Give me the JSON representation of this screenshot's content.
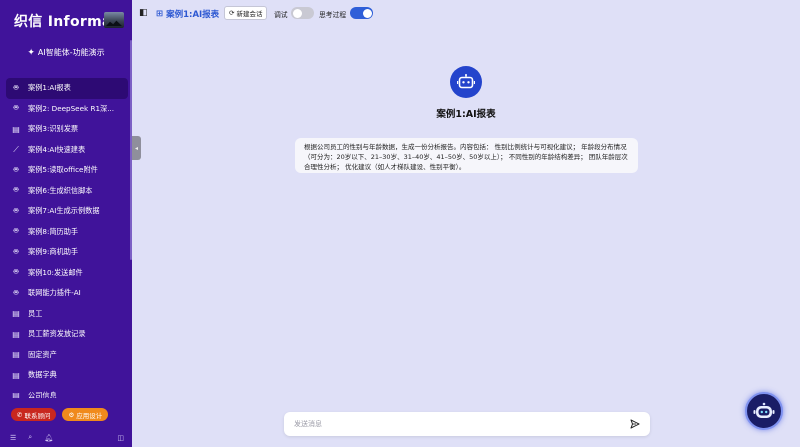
{
  "brand": {
    "logo_text": "织信 Informat",
    "subtitle": "AI智能体-功能演示"
  },
  "sidebar": {
    "items": [
      {
        "label": "案例1:AI报表",
        "icon": "robot-icon",
        "active": true
      },
      {
        "label": "案例2: DeepSeek R1深...",
        "icon": "robot-icon"
      },
      {
        "label": "案例3:识别发票",
        "icon": "table-icon"
      },
      {
        "label": "案例4:AI快速建表",
        "icon": "chart-icon"
      },
      {
        "label": "案例5:读取office附件",
        "icon": "robot-icon"
      },
      {
        "label": "案例6:生成织信脚本",
        "icon": "robot-icon"
      },
      {
        "label": "案例7:AI生成示例数据",
        "icon": "robot-icon"
      },
      {
        "label": "案例8:简历助手",
        "icon": "robot-icon"
      },
      {
        "label": "案例9:商机助手",
        "icon": "robot-icon"
      },
      {
        "label": "案例10:发送邮件",
        "icon": "robot-icon"
      },
      {
        "label": "联网能力插件-AI",
        "icon": "robot-icon"
      },
      {
        "label": "员工",
        "icon": "table-icon"
      },
      {
        "label": "员工薪资发放记录",
        "icon": "table-icon"
      },
      {
        "label": "固定资产",
        "icon": "table-icon"
      },
      {
        "label": "数据字典",
        "icon": "table-icon"
      },
      {
        "label": "公司信息",
        "icon": "table-icon"
      }
    ],
    "contact_label": "联系顾问",
    "app_design_label": "应用设计"
  },
  "header": {
    "title": "案例1:AI报表",
    "new_chat_label": "新建会话",
    "debug_label": "调试",
    "debug_on": false,
    "thinking_label": "思考过程",
    "thinking_on": true
  },
  "agent": {
    "name": "案例1:AI报表"
  },
  "prompt_card": {
    "text": "根据公司员工的性别与年龄数据，生成一份分析报告。内容包括： 性别比例统计与可视化建议； 年龄段分布情况（可分为：20岁以下、21–30岁、31–40岁、41–50岁、50岁以上）； 不同性别的年龄结构差异； 团队年龄层次合理性分析； 优化建议（如人才梯队建设、性别平衡）。"
  },
  "input": {
    "placeholder": "发送消息"
  },
  "colors": {
    "sidebar_bg": "#40139a",
    "accent": "#2f5fd8",
    "main_bg": "#dfe0f7",
    "contact": "#c8271e",
    "app_design": "#f08a1c"
  }
}
